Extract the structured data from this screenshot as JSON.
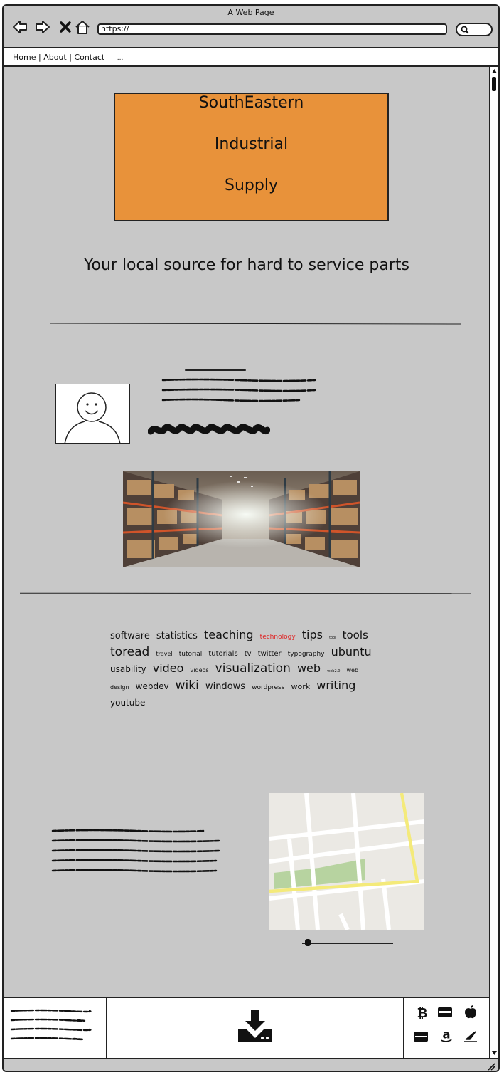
{
  "browser": {
    "window_title": "A Web Page",
    "url": "https://",
    "nav_icons": [
      "back-arrow-icon",
      "forward-arrow-icon",
      "close-x-icon",
      "home-icon"
    ],
    "search_icon": "search-icon"
  },
  "menu": {
    "items": [
      "Home",
      "About",
      "Contact"
    ],
    "separator": " | ",
    "overflow": "..."
  },
  "page": {
    "logo_lines": [
      "SouthEastern",
      "Industrial",
      "Supply"
    ],
    "logo_color": "#e8923a",
    "tagline": "Your local source for hard to service parts",
    "tags": [
      {
        "text": "software",
        "size": 13
      },
      {
        "text": "statistics",
        "size": 13
      },
      {
        "text": "teaching",
        "size": 16
      },
      {
        "text": "technology",
        "size": 9,
        "color": "#e02020"
      },
      {
        "text": "tips",
        "size": 16
      },
      {
        "text": "tool",
        "size": 5
      },
      {
        "text": "tools",
        "size": 15
      },
      {
        "text": "toread",
        "size": 17
      },
      {
        "text": "travel",
        "size": 8
      },
      {
        "text": "tutorial",
        "size": 9
      },
      {
        "text": "tutorials",
        "size": 10
      },
      {
        "text": "tv",
        "size": 10
      },
      {
        "text": "twitter",
        "size": 10
      },
      {
        "text": "typography",
        "size": 9
      },
      {
        "text": "ubuntu",
        "size": 16
      },
      {
        "text": "usability",
        "size": 12
      },
      {
        "text": "video",
        "size": 16
      },
      {
        "text": "videos",
        "size": 8
      },
      {
        "text": "visualization",
        "size": 17
      },
      {
        "text": "web",
        "size": 16
      },
      {
        "text": "web2.0",
        "size": 5
      },
      {
        "text": "web design",
        "size": 8
      },
      {
        "text": "webdev",
        "size": 12
      },
      {
        "text": "wiki",
        "size": 17
      },
      {
        "text": "windows",
        "size": 13
      },
      {
        "text": "wordpress",
        "size": 9
      },
      {
        "text": "work",
        "size": 11
      },
      {
        "text": "writing",
        "size": 16
      },
      {
        "text": "youtube",
        "size": 12
      }
    ],
    "image_subject": "warehouse-aisle-photo",
    "map_subject": "street-map"
  },
  "footer": {
    "download_icon": "download-icon",
    "payment_icons": [
      "bitcoin-icon",
      "amex-card-icon",
      "apple-icon",
      "discover-card-icon",
      "amazon-icon",
      "signature-icon"
    ]
  }
}
